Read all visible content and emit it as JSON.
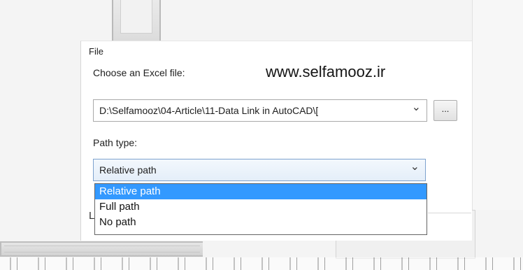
{
  "group_title": "File",
  "choose_label": "Choose an Excel file:",
  "watermark": "www.selfamooz.ir",
  "file_combo": {
    "value": "D:\\Selfamooz\\04-Article\\11-Data Link in AutoCAD\\[",
    "chevron_icon": "chevron-down-icon"
  },
  "browse_button": {
    "label": "..."
  },
  "path_type_label": "Path type:",
  "path_combo": {
    "value": "Relative path",
    "chevron_icon": "chevron-down-icon"
  },
  "path_options": [
    {
      "label": "Relative path",
      "selected": true
    },
    {
      "label": "Full path",
      "selected": false
    },
    {
      "label": "No path",
      "selected": false
    }
  ],
  "behind_letter": "L",
  "colors": {
    "selection": "#3399ff",
    "focus_border": "#7da2ce"
  }
}
